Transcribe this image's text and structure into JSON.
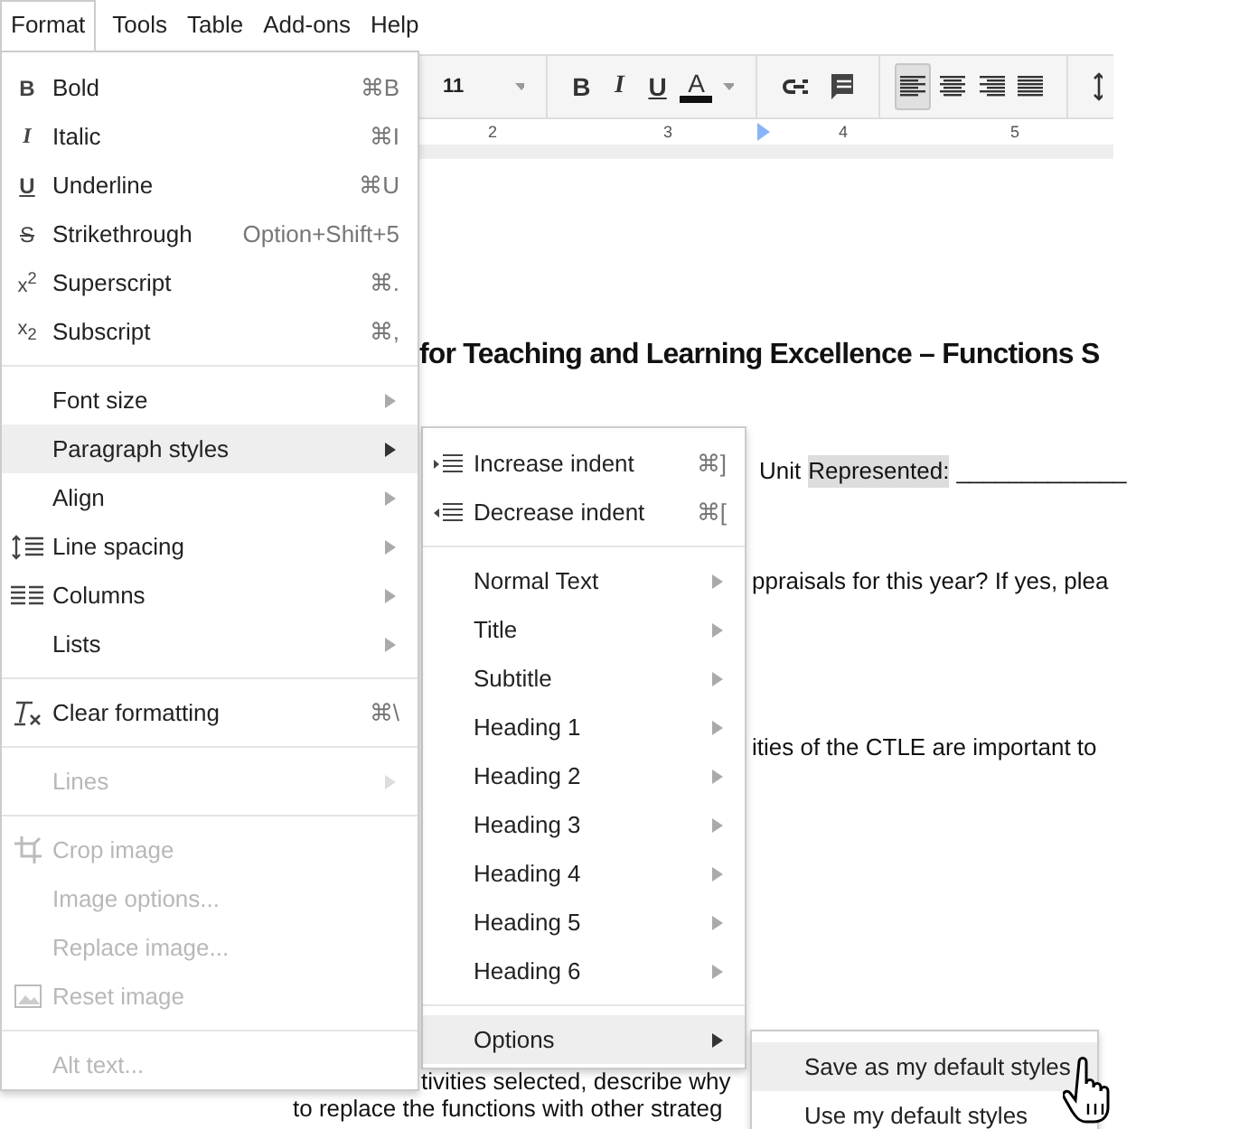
{
  "menubar": [
    {
      "label": "Format",
      "selected": true
    },
    {
      "label": "Tools",
      "selected": false
    },
    {
      "label": "Table",
      "selected": false
    },
    {
      "label": "Add-ons",
      "selected": false
    },
    {
      "label": "Help",
      "selected": false
    }
  ],
  "toolbar": {
    "font_size": "11",
    "format_buttons": [
      {
        "kind": "bold",
        "label": "B"
      },
      {
        "kind": "italic",
        "label": "I"
      },
      {
        "kind": "underline",
        "label": "U"
      },
      {
        "kind": "color",
        "label": "A"
      }
    ],
    "align_buttons": [
      {
        "kind": "left",
        "selected": true
      },
      {
        "kind": "center",
        "selected": false
      },
      {
        "kind": "right",
        "selected": false
      },
      {
        "kind": "justify",
        "selected": false
      }
    ]
  },
  "ruler": {
    "labels": [
      "2",
      "3",
      "4",
      "5"
    ]
  },
  "document": {
    "heading": "for Teaching and Learning Excellence – Functions S",
    "unit_label": "Unit",
    "unit_highlight": "Represented:",
    "unit_blank": "_____________",
    "lines": [
      "ppraisals for this year?  If yes, plea",
      "ities of the CTLE are important to"
    ],
    "bottom_lines": [
      "tivities selected, describe why",
      "to replace the functions with other strateg"
    ]
  },
  "format_menu": [
    {
      "kind": "item",
      "label": "Bold",
      "glyph": "B",
      "shortcut": "⌘B",
      "disabled": false,
      "selected": false
    },
    {
      "kind": "item",
      "label": "Italic",
      "glyph": "I",
      "shortcut": "⌘I",
      "disabled": false,
      "selected": false
    },
    {
      "kind": "item",
      "label": "Underline",
      "glyph": "U",
      "shortcut": "⌘U",
      "disabled": false,
      "selected": false
    },
    {
      "kind": "item",
      "label": "Strikethrough",
      "glyph": "S",
      "shortcut": "Option+Shift+5",
      "disabled": false,
      "selected": false
    },
    {
      "kind": "item",
      "label": "Superscript",
      "glyph": "x$^{2}$",
      "shortcut": "⌘.",
      "disabled": false,
      "selected": false
    },
    {
      "kind": "item",
      "label": "Subscript",
      "glyph": "x$_{2}$",
      "shortcut": "⌘,",
      "disabled": false,
      "selected": false
    },
    {
      "kind": "separator"
    },
    {
      "kind": "item",
      "label": "Font size",
      "submenu": true,
      "disabled": false,
      "selected": false
    },
    {
      "kind": "item",
      "label": "Paragraph styles",
      "submenu": true,
      "disabled": false,
      "selected": true
    },
    {
      "kind": "item",
      "label": "Align",
      "submenu": true,
      "disabled": false,
      "selected": false
    },
    {
      "kind": "item",
      "label": "Line spacing",
      "submenu": true,
      "disabled": false,
      "selected": false
    },
    {
      "kind": "item",
      "label": "Columns",
      "submenu": true,
      "disabled": false,
      "selected": false
    },
    {
      "kind": "item",
      "label": "Lists",
      "submenu": true,
      "disabled": false,
      "selected": false
    },
    {
      "kind": "separator"
    },
    {
      "kind": "item",
      "label": "Clear formatting",
      "shortcut": "⌘\\",
      "disabled": false,
      "selected": false
    },
    {
      "kind": "separator"
    },
    {
      "kind": "item",
      "label": "Lines",
      "submenu": true,
      "disabled": true,
      "selected": false
    },
    {
      "kind": "separator"
    },
    {
      "kind": "item",
      "label": "Crop image",
      "disabled": true,
      "selected": false
    },
    {
      "kind": "item",
      "label": "Image options...",
      "disabled": true,
      "selected": false
    },
    {
      "kind": "item",
      "label": "Replace image...",
      "disabled": true,
      "selected": false
    },
    {
      "kind": "item",
      "label": "Reset image",
      "disabled": true,
      "selected": false
    },
    {
      "kind": "separator"
    },
    {
      "kind": "item",
      "label": "Alt text...",
      "disabled": true,
      "selected": false
    }
  ],
  "paragraph_menu": [
    {
      "kind": "item",
      "label": "Increase indent",
      "shortcut": "⌘]",
      "selected": false
    },
    {
      "kind": "item",
      "label": "Decrease indent",
      "shortcut": "⌘[",
      "selected": false
    },
    {
      "kind": "separator"
    },
    {
      "kind": "item",
      "label": "Normal Text",
      "submenu": true,
      "selected": false
    },
    {
      "kind": "item",
      "label": "Title",
      "submenu": true,
      "selected": false
    },
    {
      "kind": "item",
      "label": "Subtitle",
      "submenu": true,
      "selected": false
    },
    {
      "kind": "item",
      "label": "Heading 1",
      "submenu": true,
      "selected": false
    },
    {
      "kind": "item",
      "label": "Heading 2",
      "submenu": true,
      "selected": false
    },
    {
      "kind": "item",
      "label": "Heading 3",
      "submenu": true,
      "selected": false
    },
    {
      "kind": "item",
      "label": "Heading 4",
      "submenu": true,
      "selected": false
    },
    {
      "kind": "item",
      "label": "Heading 5",
      "submenu": true,
      "selected": false
    },
    {
      "kind": "item",
      "label": "Heading 6",
      "submenu": true,
      "selected": false
    },
    {
      "kind": "separator"
    },
    {
      "kind": "item",
      "label": "Options",
      "submenu": true,
      "selected": true
    }
  ],
  "options_menu": [
    {
      "label": "Save as my default styles",
      "selected": true
    },
    {
      "label": "Use my default styles",
      "selected": false
    }
  ]
}
